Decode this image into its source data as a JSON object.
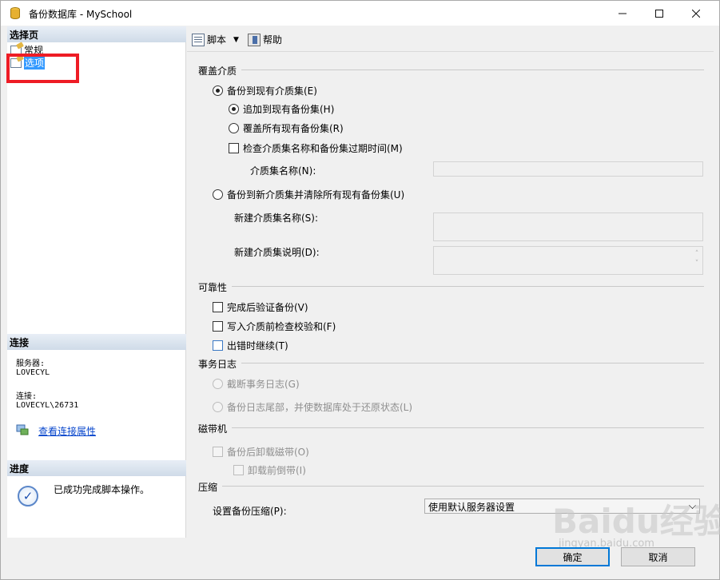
{
  "window": {
    "title": "备份数据库 - MySchool"
  },
  "left": {
    "select_page_header": "选择页",
    "nav": [
      {
        "label": "常规"
      },
      {
        "label": "选项"
      }
    ],
    "connection_header": "连接",
    "server_label": "服务器:",
    "server_value": "LOVECYL",
    "connection_label": "连接:",
    "connection_value": "LOVECYL\\26731",
    "view_connection_link": "查看连接属性",
    "progress_header": "进度",
    "progress_status": "已成功完成脚本操作。"
  },
  "toolbar": {
    "script_label": "脚本",
    "help_label": "帮助"
  },
  "media": {
    "header": "覆盖介质",
    "backup_existing": "备份到现有介质集(E)",
    "append": "追加到现有备份集(H)",
    "overwrite": "覆盖所有现有备份集(R)",
    "check_media": "检查介质集名称和备份集过期时间(M)",
    "media_set_name_label": "介质集名称(N):",
    "backup_new": "备份到新介质集并清除所有现有备份集(U)",
    "new_media_name_label": "新建介质集名称(S):",
    "new_media_desc_label": "新建介质集说明(D):"
  },
  "reliability": {
    "header": "可靠性",
    "verify": "完成后验证备份(V)",
    "checksum": "写入介质前检查校验和(F)",
    "continue_on_error": "出错时继续(T)"
  },
  "transaction_log": {
    "header": "事务日志",
    "truncate": "截断事务日志(G)",
    "tail": "备份日志尾部，并使数据库处于还原状态(L)"
  },
  "tape": {
    "header": "磁带机",
    "unload": "备份后卸载磁带(O)",
    "rewind": "卸载前倒带(I)"
  },
  "compression": {
    "header": "压缩",
    "setting_label": "设置备份压缩(P):",
    "setting_value": "使用默认服务器设置"
  },
  "buttons": {
    "ok": "确定",
    "cancel": "取消"
  },
  "watermark": {
    "brand": "Baidu经验",
    "url": "jingyan.baidu.com"
  }
}
